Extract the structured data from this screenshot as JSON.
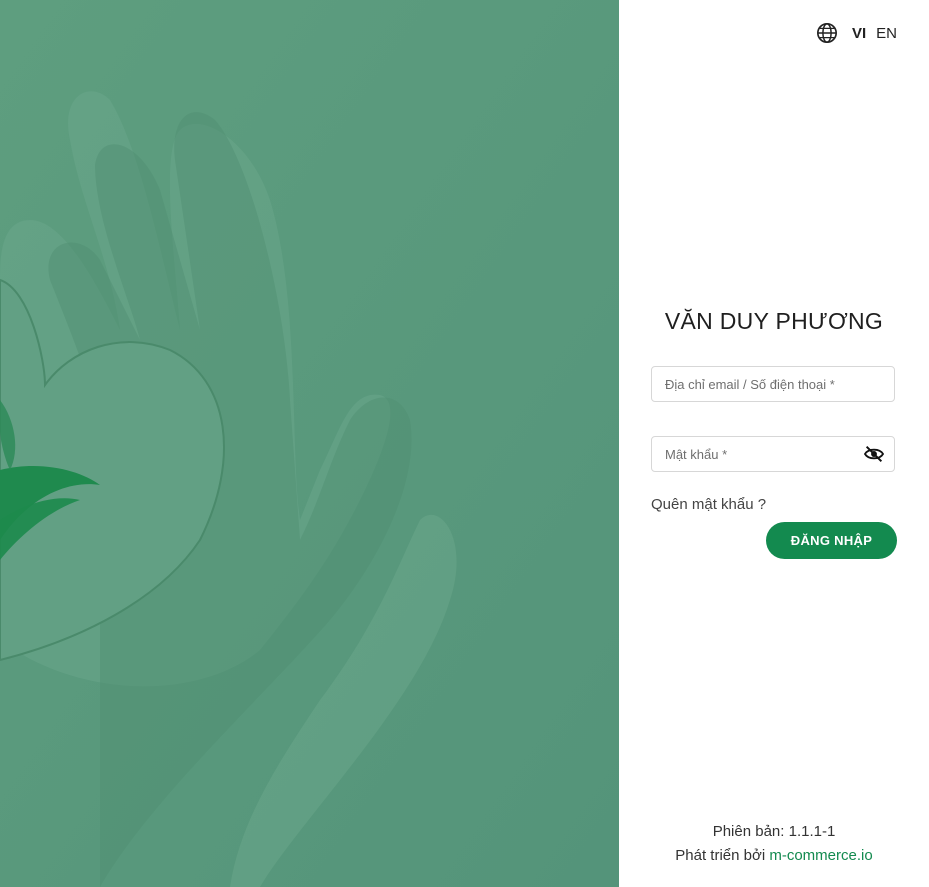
{
  "language": {
    "options": [
      "VI",
      "EN"
    ],
    "active": "VI"
  },
  "login": {
    "title": "VĂN DUY PHƯƠNG",
    "email_placeholder": "Địa chỉ email / Số điện thoại *",
    "email_value": "",
    "password_placeholder": "Mật khẩu *",
    "password_value": "",
    "forgot_label": "Quên mật khẩu ?",
    "submit_label": "ĐĂNG NHẬP"
  },
  "footer": {
    "version_label": "Phiên bản: 1.1.1-1",
    "developed_by_label": "Phát triển bởi",
    "developer_link": "m-commerce.io"
  },
  "icons": {
    "language": "globe-icon",
    "password_visibility": "eye-slash-icon"
  },
  "colors": {
    "brand": "#138a4f",
    "hero_tint": "#5a9a7b"
  }
}
